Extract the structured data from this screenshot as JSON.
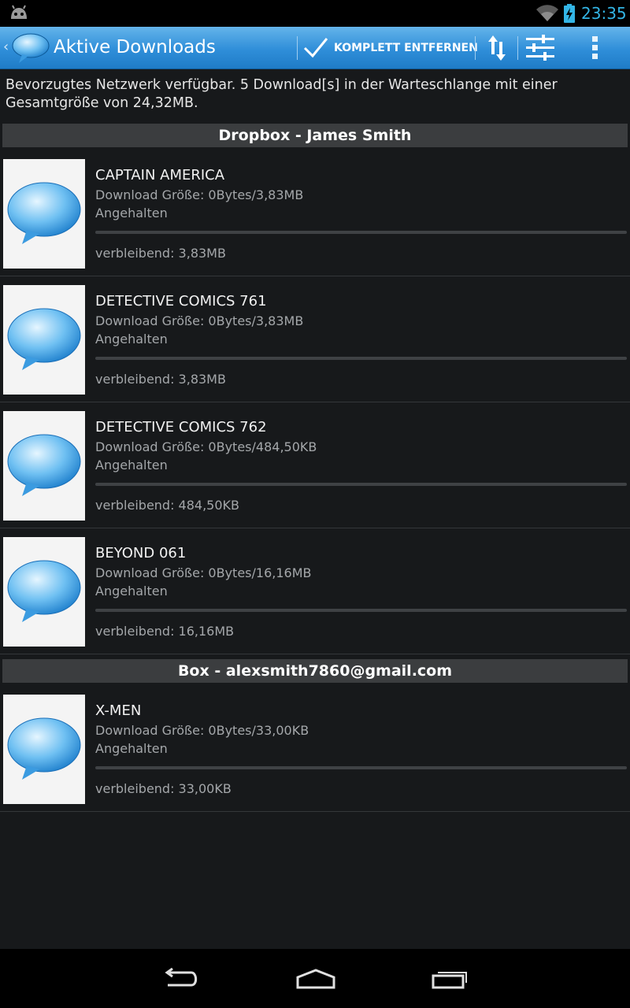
{
  "status_bar": {
    "time": "23:35",
    "icons": [
      "android-icon",
      "wifi-icon",
      "battery-charging-icon"
    ]
  },
  "action_bar": {
    "title": "Aktive Downloads",
    "remove_all_label": "KOMPLETT ENTFERNEN",
    "icons": [
      "app-speech-bubble-icon",
      "checkmark-icon",
      "sort-arrows-icon",
      "sliders-icon",
      "overflow-menu-icon"
    ]
  },
  "info": {
    "text": "Bevorzugtes Netzwerk verfügbar. 5 Download[s] in der Warteschlange mit einer Gesamtgröße von 24,32MB."
  },
  "groups": [
    {
      "header": "Dropbox - James Smith",
      "items": [
        {
          "name": "CAPTAIN AMERICA",
          "size": "Download Größe: 0Bytes/3,83MB",
          "state": "Angehalten",
          "remaining": "verbleibend: 3,83MB",
          "progress": 0
        },
        {
          "name": "DETECTIVE COMICS 761",
          "size": "Download Größe: 0Bytes/3,83MB",
          "state": "Angehalten",
          "remaining": "verbleibend: 3,83MB",
          "progress": 0
        },
        {
          "name": "DETECTIVE COMICS 762",
          "size": "Download Größe: 0Bytes/484,50KB",
          "state": "Angehalten",
          "remaining": "verbleibend: 484,50KB",
          "progress": 0
        },
        {
          "name": "BEYOND 061",
          "size": "Download Größe: 0Bytes/16,16MB",
          "state": "Angehalten",
          "remaining": "verbleibend: 16,16MB",
          "progress": 0
        }
      ]
    },
    {
      "header": "Box - alexsmith7860@gmail.com",
      "items": [
        {
          "name": "X-MEN",
          "size": "Download Größe: 0Bytes/33,00KB",
          "state": "Angehalten",
          "remaining": "verbleibend: 33,00KB",
          "progress": 0
        }
      ]
    }
  ],
  "nav_bar": {
    "icons": [
      "back-icon",
      "home-icon",
      "recent-apps-icon"
    ]
  },
  "colors": {
    "accent": "#33b5e5",
    "action_bar": "#2f8ed9",
    "background": "#17191b",
    "section_header": "#3b3d3f"
  }
}
